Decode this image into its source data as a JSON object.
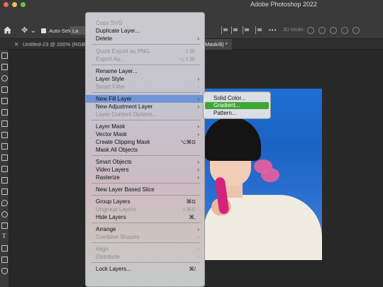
{
  "window": {
    "title": "Adobe Photoshop 2022"
  },
  "colors": {
    "highlight": "#6c92d6",
    "submenu_selected": "#3fa837",
    "close": "#ed6a5e",
    "minimize": "#f5bf4f",
    "zoom": "#61c554"
  },
  "options_bar": {
    "auto_select_label": "Auto-Select:",
    "layer_dropdown": "La",
    "mode_3d_label": "3D Mode:",
    "more_label": "•••"
  },
  "tabs": [
    {
      "label": "Untitled-23 @ 200% (RGB/"
    },
    {
      "label": "Mask/8) *"
    }
  ],
  "menu": {
    "copy_svg": "Copy SVG",
    "duplicate_layer": "Duplicate Layer...",
    "delete": "Delete",
    "quick_export": "Quick Export as PNG",
    "quick_export_sc": "⇧⌘'",
    "export_as": "Export As...",
    "export_as_sc": "⌥⇧⌘'",
    "rename_layer": "Rename Layer...",
    "layer_style": "Layer Style",
    "smart_filter": "Smart Filter",
    "new_fill_layer": "New Fill Layer",
    "new_adjustment_layer": "New Adjustment Layer",
    "layer_content_options": "Layer Content Options...",
    "layer_mask": "Layer Mask",
    "vector_mask": "Vector Mask",
    "create_clipping_mask": "Create Clipping Mask",
    "create_clipping_mask_sc": "⌥⌘G",
    "mask_all_objects": "Mask All Objects",
    "smart_objects": "Smart Objects",
    "video_layers": "Video Layers",
    "rasterize": "Rasterize",
    "new_layer_based_slice": "New Layer Based Slice",
    "group_layers": "Group Layers",
    "group_layers_sc": "⌘G",
    "ungroup_layers": "Ungroup Layers",
    "ungroup_layers_sc": "⇧⌘G",
    "hide_layers": "Hide Layers",
    "hide_layers_sc": "⌘,",
    "arrange": "Arrange",
    "combine_shapes": "Combine Shapes",
    "align": "Align",
    "distribute": "Distribute",
    "lock_layers": "Lock Layers...",
    "lock_layers_sc": "⌘/"
  },
  "submenu": {
    "solid_color": "Solid Color...",
    "gradient": "Gradient...",
    "pattern": "Pattern..."
  },
  "toolbar": {
    "type_tool_glyph": "T"
  }
}
